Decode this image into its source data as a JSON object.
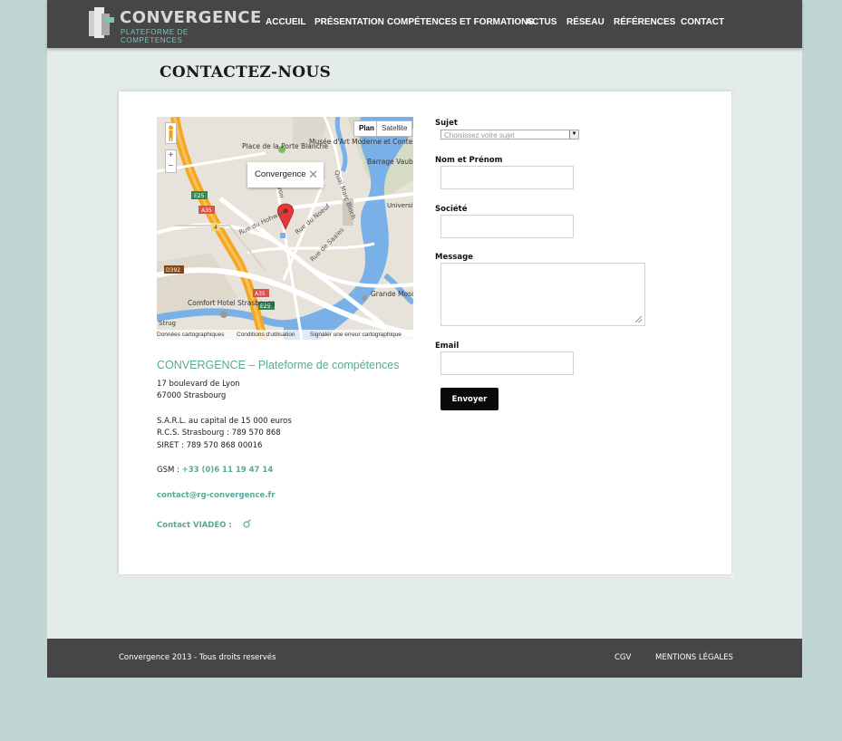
{
  "header": {
    "logo_title": "CONVERGENCE",
    "logo_subtitle": "PLATEFORME DE COMPÉTENCES",
    "nav": [
      "ACCUEIL",
      "PRÉSENTATION",
      "COMPÉTENCES ET FORMATIONS",
      "ACTUS",
      "RÉSEAU",
      "RÉFÉRENCES",
      "CONTACT"
    ]
  },
  "page_title": "CONTACTEZ-NOUS",
  "map": {
    "toggle_plan": "Plan",
    "toggle_satellite": "Satellite",
    "zoom_in": "+",
    "zoom_out": "−",
    "infowindow_label": "Convergence",
    "infowindow_close": "✕",
    "labels": {
      "place_porte_blanche": "Place de la Porte Blanche",
      "musee": "Musée d'Art Moderne et Contemporain",
      "barrage": "Barrage Vauban",
      "quai": "Quai Marc Bloch",
      "universite": "Universit Strasbou",
      "rue_hohwald": "Rue du Hohwald",
      "rue_noeuf": "Rue du Noeuf",
      "rue_saales": "Rue de Saales",
      "lyon": "Lyon",
      "comfort_hotel": "Comfort Hotel Strasbourg",
      "grande_mosq": "Grande Mosq de Strasbour",
      "e25_top": "E25",
      "a35_top": "A35",
      "route_4": "4",
      "d392": "D392",
      "a35_bottom": "A35",
      "e25_bottom": "E25",
      "strug": "Strug"
    },
    "footer": [
      "Données cartographiques",
      "Conditions d'utilisation",
      "Signaler une erreur cartographique"
    ]
  },
  "contact": {
    "company": "CONVERGENCE – Plateforme de compétences",
    "address_line1": "17 boulevard de Lyon",
    "address_line2": "67000 Strasbourg",
    "sarl": "S.A.R.L. au capital de 15 000 euros",
    "rcs": "R.C.S. Strasbourg : 789 570 868",
    "siret": "SIRET : 789 570 868 00016",
    "gsm_label": "GSM : ",
    "gsm_value": "+33 (0)6 11 19 47 14",
    "email": "contact@rg-convergence.fr",
    "viadeo_label": "Contact VIADEO :",
    "viadeo_icon": "viadeo-icon"
  },
  "form": {
    "sujet_label": "Sujet",
    "sujet_placeholder": "Choisissez votre sujet",
    "nom_label": "Nom et Prénom",
    "societe_label": "Société",
    "message_label": "Message",
    "email_label": "Email",
    "submit_label": "Envoyer"
  },
  "footer": {
    "copyright": "Convergence 2013 - Tous droits reservés",
    "cgv": "CGV",
    "mentions": "MENTIONS LÉGALES"
  },
  "colors": {
    "accent": "#5aa898",
    "header_bg": "#464646",
    "outer_bg": "#bfd6d4"
  }
}
